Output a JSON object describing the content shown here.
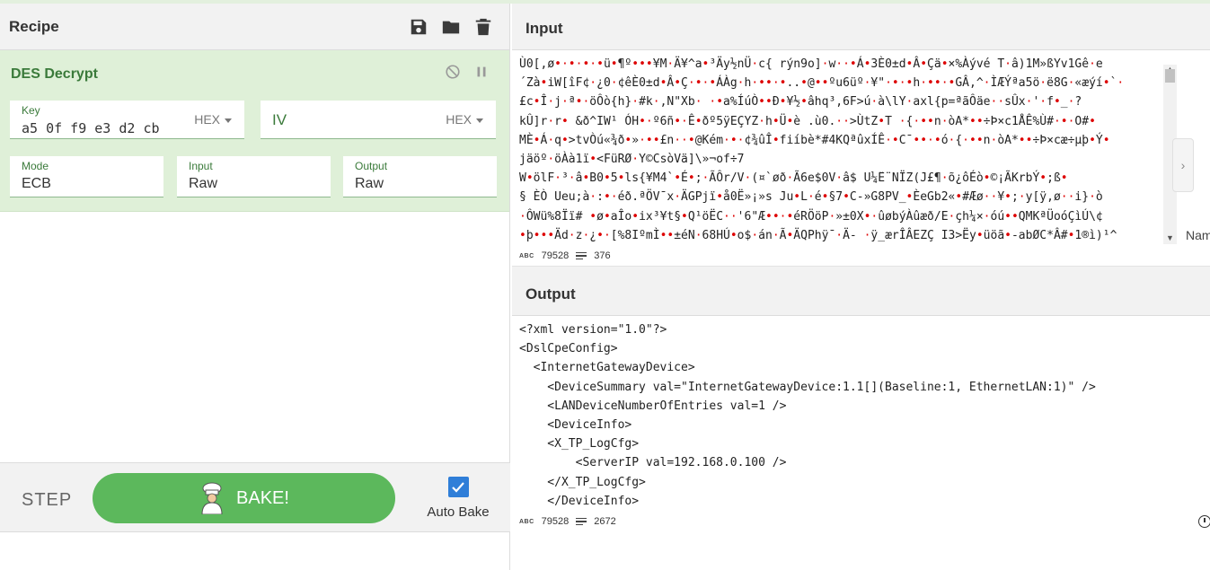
{
  "recipe": {
    "title": "Recipe",
    "icons": [
      "save-icon",
      "folder-icon",
      "trash-icon"
    ],
    "operation": {
      "name": "DES Decrypt",
      "key_label": "Key",
      "key_value": "a5 0f f9 e3 d2 cb",
      "key_format": "HEX",
      "iv_label": "IV",
      "iv_format": "HEX",
      "mode_label": "Mode",
      "mode_value": "ECB",
      "input_label": "Input",
      "input_value": "Raw",
      "output_label": "Output",
      "output_value": "Raw"
    },
    "step_label": "STEP",
    "bake_label": "BAKE!",
    "auto_bake_label": "Auto Bake",
    "auto_bake_checked": true
  },
  "input": {
    "title": "Input",
    "lines": [
      "Ù0[,ø•·•·•·•ü•¶º•••¥M·Ä¥^a•³Äy½nÜ·c{ rýn9o]·w··•Á•3È0±d•Â•Çä•×%Àývé    T·â)1M»ßYv1Gê·e",
      "´Zà•iW[îF¢·¿0·¢êÈ0±d•Â•Ç·•·•ÁÀg·h·••·•..•@••ºu6üº·¥\"·•·•h·••·•GÂ,^·ÌÆÝªa5ö·ë8G·«æýí•`·",
      "£c•Î·j·ª•·öÔò{h}·#k·,N\"Xb· ·•a%ÍúÒ••Ð•¥½•âhq³,6F>ú·à\\lY·axl{p=ªãÔäe··sÛx·'·f•_·?",
      "kÛ]r·r• &ð^IW¹ ÓH•·º6ñ•·Ê•ðº5ÿEÇYZ·h•Ü•è .ù0.··>ÙtZ•T ·{·••n·òA*••÷Þ×c1ÅÊ%Ù#·•·O#•",
      "MÈ•Á·q•>tvÒú«¾ð•»·••£n··•@Kém·•·¢¾ûÎ•fiíbè*#4KQªûxÍÊ·•C¯••·•ó·{·••n·òA*••÷Þ×cæ÷µþ•Ý•",
      "jäöº·öÀà1ï•<FüRØ·Y©CsòVä]\\»¬of÷7",
      "W•ölF·³·â•B0•5•ls{¥M4`•É•;·ÃÔr/V·(¤`øð·Ã6e$0V·â$ U¼̈E¨NÏZ(J£¶·õ¿ôÉò•©¡ÃKrbÝ•;ß•",
      "§ ÈÒ Ueu;à·:•·éð.ªÖV¯x·ÄGPjï•å0Ë»¡»s Ju•L·é•§7•C-»G8PV_•ÈeGb2«•#Æø··¥•;·y[ÿ,ø··i}·ò",
      "·ÔWü%8Ïï# •ø•aÎo•ix³¥t§•Q¹öËC··'6\"Æ••·•éRÖöP·»±0X•·ûøbýÀûæð/E·çh¼×·óú••QMKªÜoóÇìÚ\\¢",
      "•þ•••Äd·z·¿•·[%8IºmÌ••±éN·68HÚ•o$·án·Ã•ÄQPhÿ¯·Ä- ·ÿ_ærÎÂEZÇ I3>Ëy•üöã•-abØC*Â#•1®ì)¹^"
    ],
    "length": "79528",
    "line_count": "376",
    "side_label": "Nam"
  },
  "output": {
    "title": "Output",
    "lines": [
      "<?xml version=\"1.0\"?>",
      "<DslCpeConfig>",
      "  <InternetGatewayDevice>",
      "    <DeviceSummary val=\"InternetGatewayDevice:1.1[](Baseline:1, EthernetLAN:1)\" />",
      "    <LANDeviceNumberOfEntries val=1 />",
      "    <DeviceInfo>",
      "    <X_TP_LogCfg>",
      "        <ServerIP val=192.168.0.100 />",
      "    </X_TP_LogCfg>",
      "    </DeviceInfo>"
    ],
    "length": "79528",
    "line_count": "2672"
  }
}
